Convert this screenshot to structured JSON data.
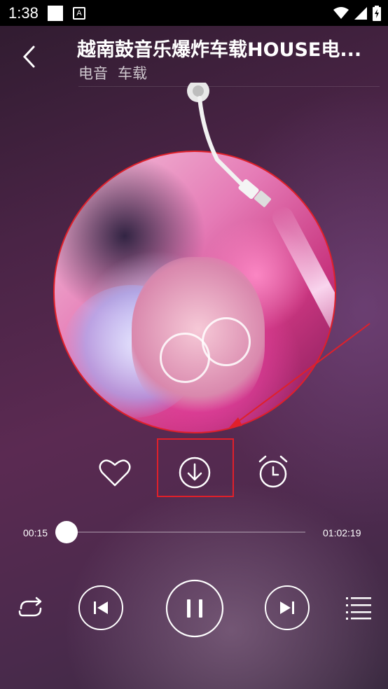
{
  "status_bar": {
    "time": "1:38",
    "a_icon": "A"
  },
  "song": {
    "title": "越南鼓音乐爆炸车载HOUSE电...",
    "tags": [
      "电音",
      "车载"
    ]
  },
  "progress": {
    "current": "00:15",
    "total": "01:02:19",
    "fraction": 0.004
  },
  "icons": {
    "back": "chevron-left-icon",
    "favorite": "heart-icon",
    "download": "download-icon",
    "timer": "alarm-clock-icon",
    "repeat": "repeat-icon",
    "previous": "skip-previous-icon",
    "play_pause": "pause-icon",
    "next": "skip-next-icon",
    "playlist": "playlist-icon"
  },
  "colors": {
    "highlight": "#e0202a"
  }
}
